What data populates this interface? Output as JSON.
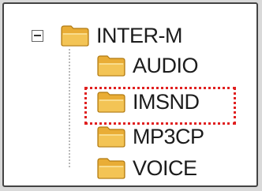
{
  "tree": {
    "root": {
      "label": "INTER-M",
      "expanded": true,
      "toggle_icon": "collapse-minus-icon",
      "folder_icon": "folder-icon"
    },
    "children": [
      {
        "label": "AUDIO",
        "folder_icon": "folder-icon",
        "selected": false
      },
      {
        "label": "IMSND",
        "folder_icon": "folder-icon",
        "selected": true
      },
      {
        "label": "MP3CP",
        "folder_icon": "folder-icon",
        "selected": false
      },
      {
        "label": "VOICE",
        "folder_icon": "folder-icon",
        "selected": false
      }
    ]
  },
  "colors": {
    "folder_body": "#f3c455",
    "folder_tab": "#e9ad36",
    "folder_outline": "#b07a12",
    "highlight_border": "#e02020",
    "frame_border": "#444444",
    "background": "#d9d9d9"
  }
}
